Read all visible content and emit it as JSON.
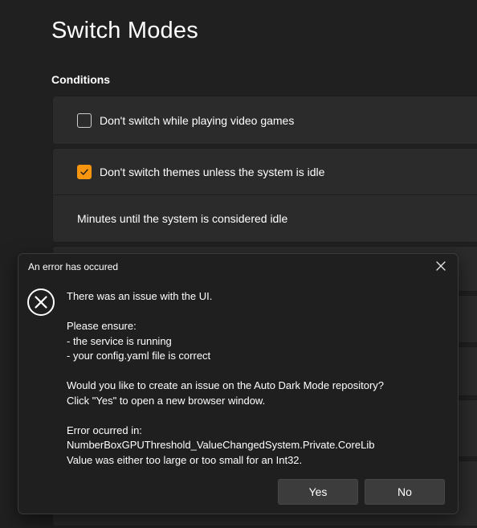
{
  "page": {
    "title": "Switch Modes",
    "section_title": "Conditions"
  },
  "conditions": {
    "video_games": {
      "label": "Don't switch while playing video games",
      "checked": false
    },
    "idle": {
      "label": "Don't switch themes unless the system is idle",
      "checked": true
    },
    "idle_minutes": {
      "label": "Minutes until the system is considered idle"
    }
  },
  "dialog": {
    "title": "An error has occured",
    "close_icon": "close-icon",
    "error_icon": "error-circle-x-icon",
    "line1": "There was an issue with the UI.",
    "ensure_header": "Please ensure:",
    "ensure_item1": "- the service is running",
    "ensure_item2": "- your config.yaml file is correct",
    "question_line1": "Would you like to create an issue on the Auto Dark Mode repository?",
    "question_line2": "Click \"Yes\" to open a new browser window.",
    "error_header": "Error ocurred in:",
    "error_source": "NumberBoxGPUThreshold_ValueChangedSystem.Private.CoreLib",
    "error_message": "Value was either too large or too small for an Int32.",
    "yes_label": "Yes",
    "no_label": "No"
  },
  "colors": {
    "accent": "#f7950f",
    "background": "#202020",
    "card": "#2b2b2b",
    "dialog": "#1f1f1f"
  }
}
